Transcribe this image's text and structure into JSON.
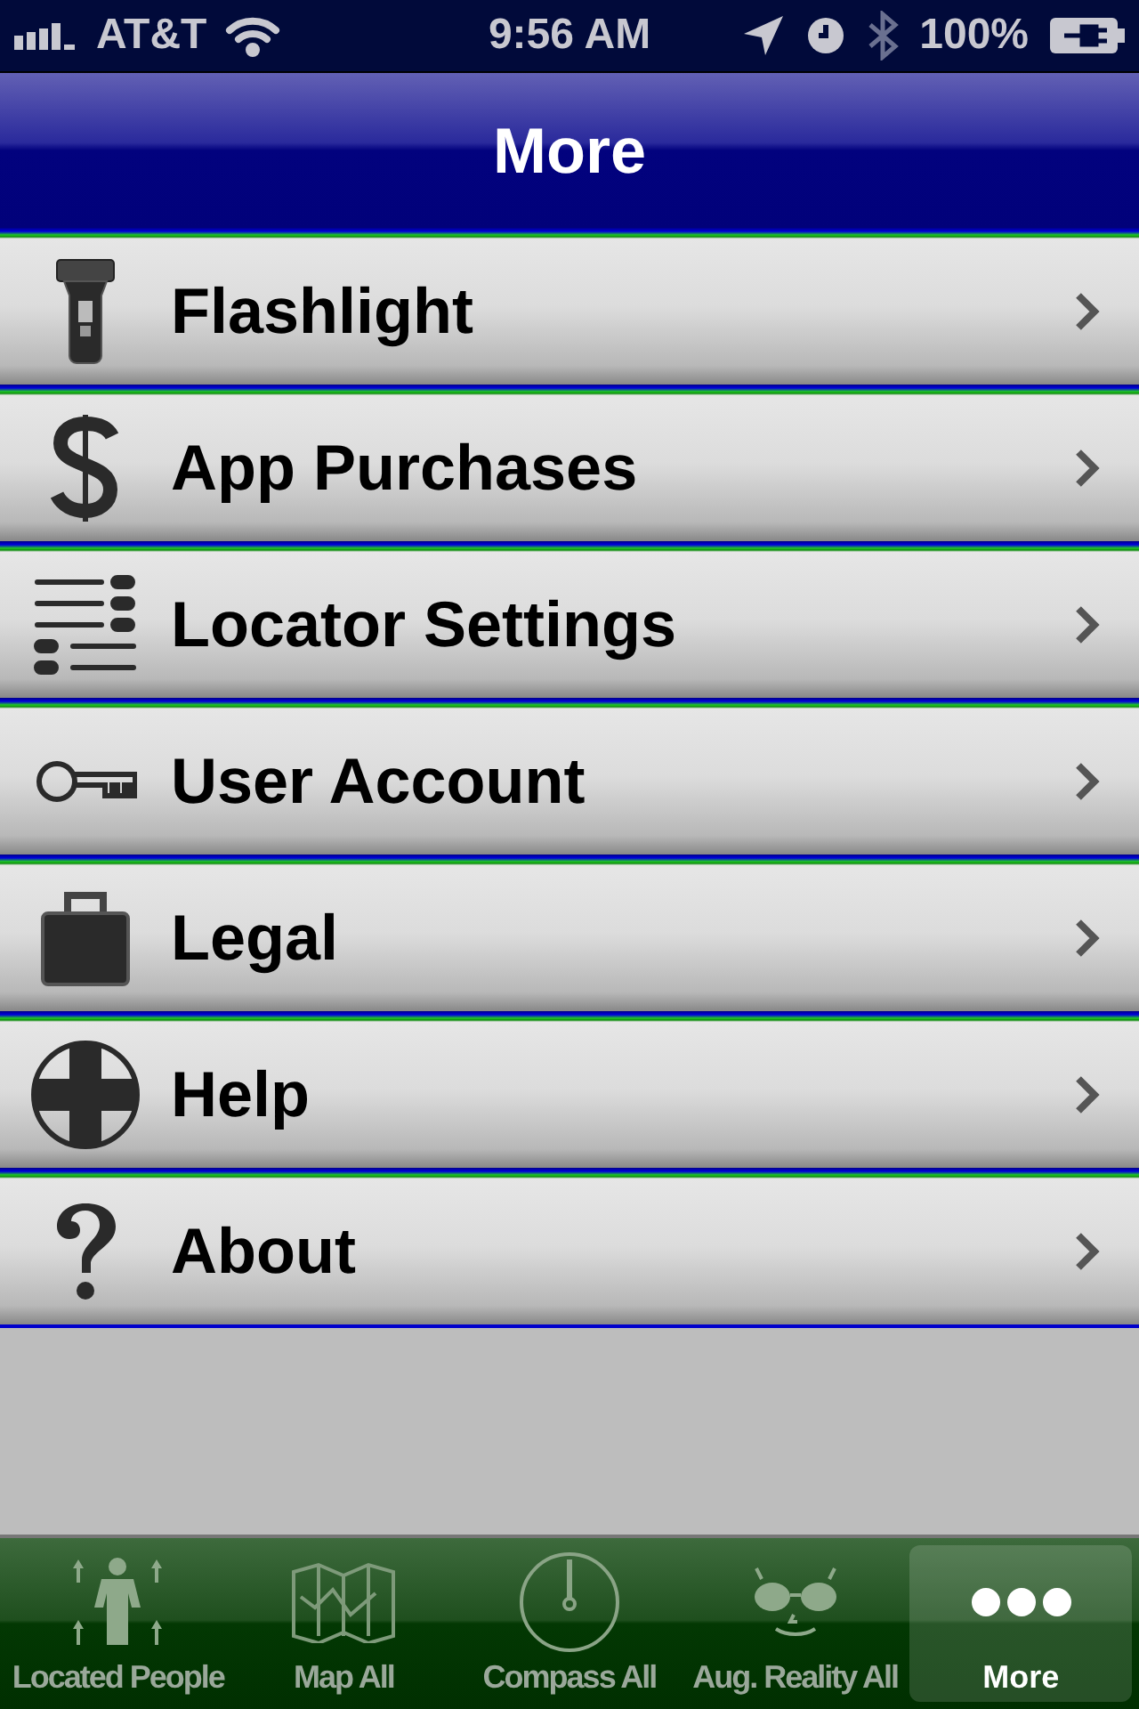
{
  "status_bar": {
    "carrier": "AT&T",
    "time": "9:56 AM",
    "battery": "100%"
  },
  "nav_bar": {
    "title": "More"
  },
  "menu": [
    {
      "label": "Flashlight"
    },
    {
      "label": "App Purchases"
    },
    {
      "label": "Locator Settings"
    },
    {
      "label": "User Account"
    },
    {
      "label": "Legal"
    },
    {
      "label": "Help"
    },
    {
      "label": "About"
    }
  ],
  "tabs": [
    {
      "label": "Located People",
      "selected": false
    },
    {
      "label": "Map All",
      "selected": false
    },
    {
      "label": "Compass All",
      "selected": false
    },
    {
      "label": "Aug. Reality All",
      "selected": false
    },
    {
      "label": "More",
      "selected": true
    }
  ]
}
